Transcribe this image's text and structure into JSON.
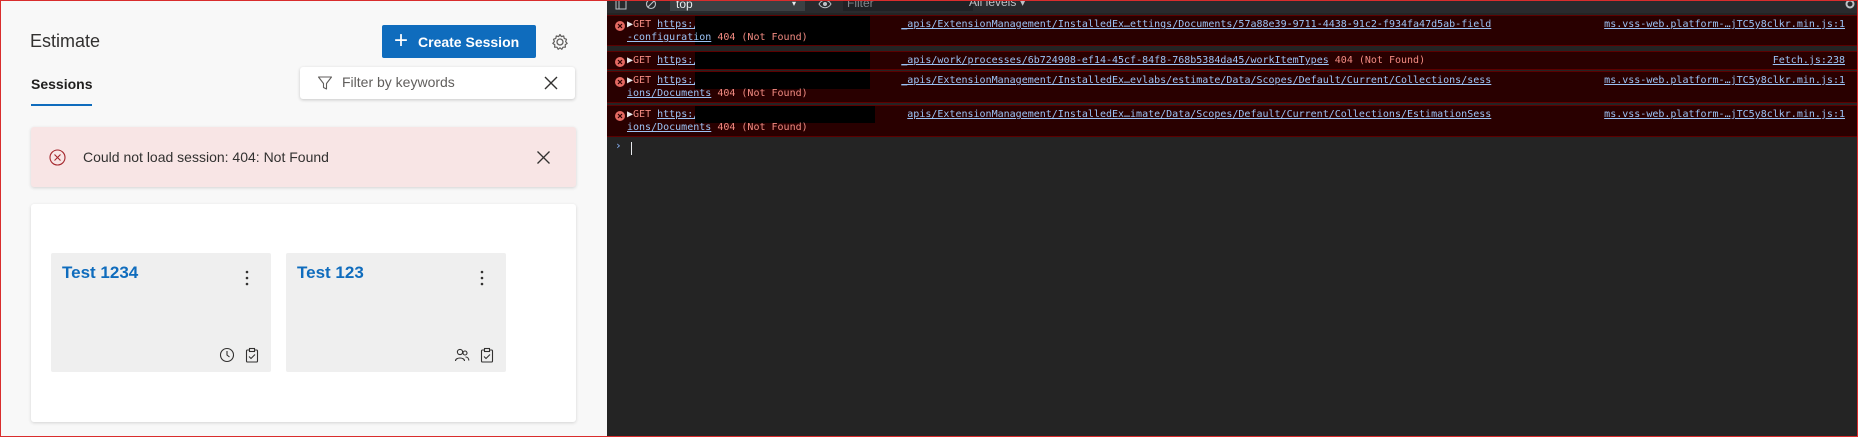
{
  "app": {
    "title": "Estimate",
    "create_button_label": "Create Session",
    "tab_sessions_label": "Sessions",
    "filter_placeholder": "Filter by keywords",
    "error_message": "Could not load session: 404: Not Found",
    "cards": [
      {
        "title": "Test 1234",
        "icons": [
          "clock-icon",
          "clipboard-icon"
        ]
      },
      {
        "title": "Test 123",
        "icons": [
          "people-icon",
          "clipboard-icon"
        ]
      }
    ],
    "colors": {
      "accent": "#0f6cbd",
      "error_bg": "#f8e5e5",
      "error_icon": "#a4262c"
    }
  },
  "devtools": {
    "context_label": "top",
    "filter_placeholder": "Filter",
    "levels_label": "All levels ▾",
    "entries": [
      {
        "method": "GET",
        "url_prefix": "https:/",
        "url_rest": "_apis/ExtensionManagement/InstalledEx…ettings/Documents/57a88e39-9711-4438-91c2-f934fa47d5ab-field",
        "url_wrap": "-configuration",
        "status": "404 (Not Found)",
        "source": "ms.vss-web.platform-…jTC5y8clkr.min.js:1"
      },
      {
        "method": "GET",
        "url_prefix": "https:/",
        "url_rest": "_apis/work/processes/6b724908-ef14-45cf-84f8-768b5384da45/workItemTypes",
        "status": "404 (Not Found)",
        "source": "Fetch.js:238"
      },
      {
        "method": "GET",
        "url_prefix": "https:/",
        "url_rest": "_apis/ExtensionManagement/InstalledEx…evlabs/estimate/Data/Scopes/Default/Current/Collections/sess",
        "url_wrap": "ions/Documents",
        "status": "404 (Not Found)",
        "source": "ms.vss-web.platform-…jTC5y8clkr.min.js:1"
      },
      {
        "method": "GET",
        "url_prefix": "https:/",
        "url_rest": "apis/ExtensionManagement/InstalledEx…imate/Data/Scopes/Default/Current/Collections/EstimationSess",
        "url_wrap": "ions/Documents",
        "status": "404 (Not Found)",
        "source": "ms.vss-web.platform-…jTC5y8clkr.min.js:1"
      }
    ],
    "prompt_symbol": "›"
  }
}
